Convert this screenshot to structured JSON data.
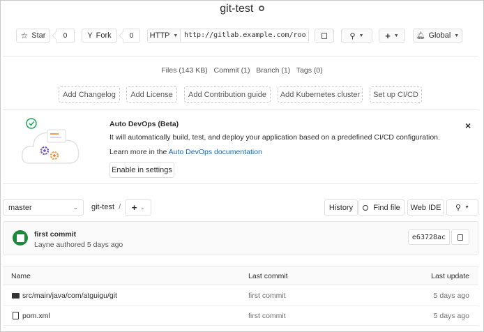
{
  "project": {
    "title": "git-test",
    "visibility_icon": "globe-icon"
  },
  "actions": {
    "star_label": "Star",
    "star_count": "0",
    "fork_label": "Fork",
    "fork_count": "0",
    "protocol_label": "HTTP",
    "clone_url": "http://gitlab.example.com/roo",
    "notification_label": "Global"
  },
  "stats": {
    "files": "Files (143 KB)",
    "commits": "Commit (1)",
    "branches": "Branch (1)",
    "tags": "Tags (0)"
  },
  "quick_actions": [
    "Add Changelog",
    "Add License",
    "Add Contribution guide",
    "Add Kubernetes cluster",
    "Set up CI/CD"
  ],
  "autodevops": {
    "title": "Auto DevOps (Beta)",
    "description": "It will automatically build, test, and deploy your application based on a predefined CI/CD configuration.",
    "learn_prefix": "Learn more in the ",
    "learn_link": "Auto DevOps documentation",
    "enable_label": "Enable in settings",
    "close_glyph": "×"
  },
  "repo_nav": {
    "branch": "master",
    "path": "git-test",
    "separator": "/",
    "add_glyph": "+",
    "history_label": "History",
    "find_file_label": "Find file",
    "web_ide_label": "Web IDE"
  },
  "last_commit": {
    "title": "first commit",
    "author_line": "Layne authored 5 days ago",
    "sha": "e63728ac"
  },
  "table": {
    "headers": {
      "name": "Name",
      "last_commit": "Last commit",
      "last_update": "Last update"
    },
    "rows": [
      {
        "type": "folder",
        "name": "src/main/java/com/atguigu/git",
        "commit": "first commit",
        "updated": "5 days ago"
      },
      {
        "type": "file",
        "name": "pom.xml",
        "commit": "first commit",
        "updated": "5 days ago"
      }
    ]
  },
  "colors": {
    "link": "#1b69b6",
    "avatar": "#1a8a3a",
    "illustration_accent": "#e8a03c",
    "illustration_purple": "#6b4fbb",
    "illustration_green": "#1aaa55"
  }
}
